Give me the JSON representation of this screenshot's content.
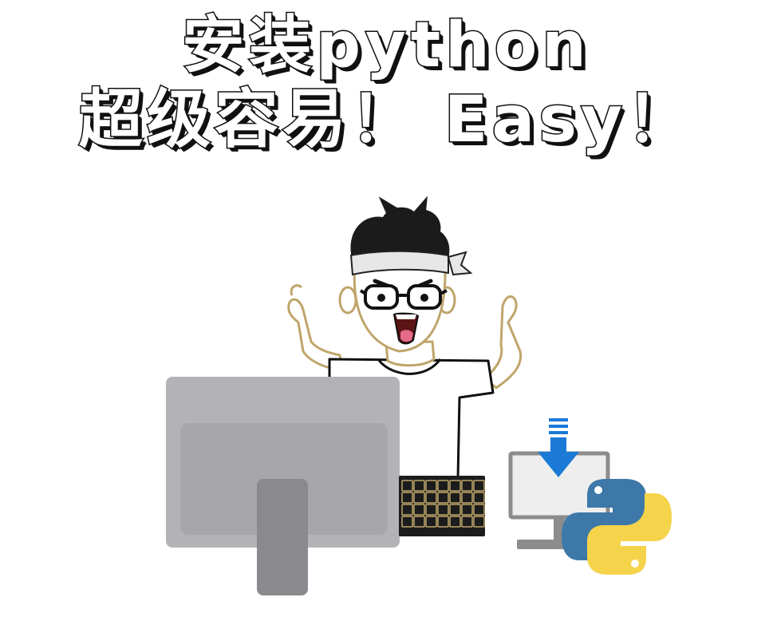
{
  "title": {
    "line1": "安装python",
    "line2": "超级容易！ Easy！"
  },
  "illustration": {
    "character": "person-with-headband",
    "monitor": "monitor-back",
    "keyboard": "keyboard",
    "download_icon": "download-arrow-icon",
    "python_logo": "python-logo-icon"
  },
  "colors": {
    "monitor": "#b3b2b7",
    "monitor_inner": "#a7a6ab",
    "stand": "#8a898e",
    "skin_outline": "#bfa56b",
    "headband": "#e7e7e7",
    "arrow": "#1a7ad6",
    "python_blue": "#3d78a9",
    "python_yellow": "#f5d34a"
  }
}
